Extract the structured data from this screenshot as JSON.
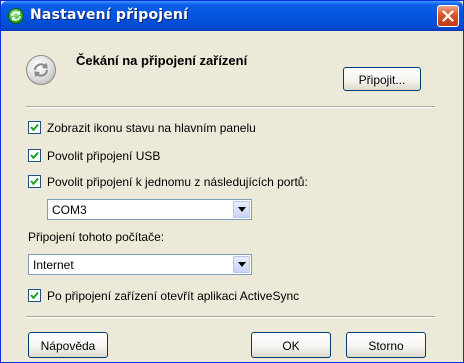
{
  "window": {
    "title": "Nastavení připojení"
  },
  "status": {
    "title": "Čekání na připojení zařízení",
    "connect_label": "Připojit..."
  },
  "options": {
    "show_status_icon": {
      "label": "Zobrazit ikonu stavu na hlavním panelu",
      "checked": true
    },
    "allow_usb": {
      "label": "Povolit připojení USB",
      "checked": true
    },
    "allow_port": {
      "label": "Povolit připojení k jednomu z následujících portů:",
      "checked": true
    },
    "port_select": {
      "value": "COM3"
    },
    "computer_connection_label": "Připojení tohoto počítače:",
    "connection_select": {
      "value": "Internet"
    },
    "open_activesync": {
      "label": "Po připojení zařízení otevřít aplikaci ActiveSync",
      "checked": true
    }
  },
  "footer": {
    "help_label": "Nápověda",
    "ok_label": "OK",
    "cancel_label": "Storno"
  },
  "icons": {
    "title": "activesync-icon",
    "close": "close-icon",
    "status": "sync-arrows-icon",
    "check": "checkmark-icon",
    "dropdown": "chevron-down-icon"
  },
  "colors": {
    "titlebar": "#0554e0",
    "dialog_bg": "#ece9d8",
    "close_button": "#d9552c",
    "button_border": "#003c74"
  }
}
